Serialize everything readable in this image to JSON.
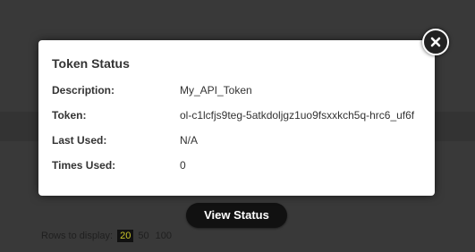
{
  "modal": {
    "title": "Token Status",
    "rows": [
      {
        "label": "Description:",
        "value": "My_API_Token"
      },
      {
        "label": "Token:",
        "value": "ol-c1lcfjs9teg-5atkdoljgz1uo9fsxxkch5q-hrc6_uf6f"
      },
      {
        "label": "Last Used:",
        "value": "N/A"
      },
      {
        "label": "Times Used:",
        "value": "0"
      }
    ],
    "close_icon": "close-icon"
  },
  "background": {
    "view_status_label": "View Status",
    "rows_to_display_label": "Rows to display:",
    "rows_options": [
      "20",
      "50",
      "100"
    ],
    "rows_selected": "20"
  },
  "colors": {
    "overlay": "#393939",
    "modal_bg": "#ffffff",
    "button_bg": "#111111",
    "selected_rows_text": "#c9c42a"
  }
}
